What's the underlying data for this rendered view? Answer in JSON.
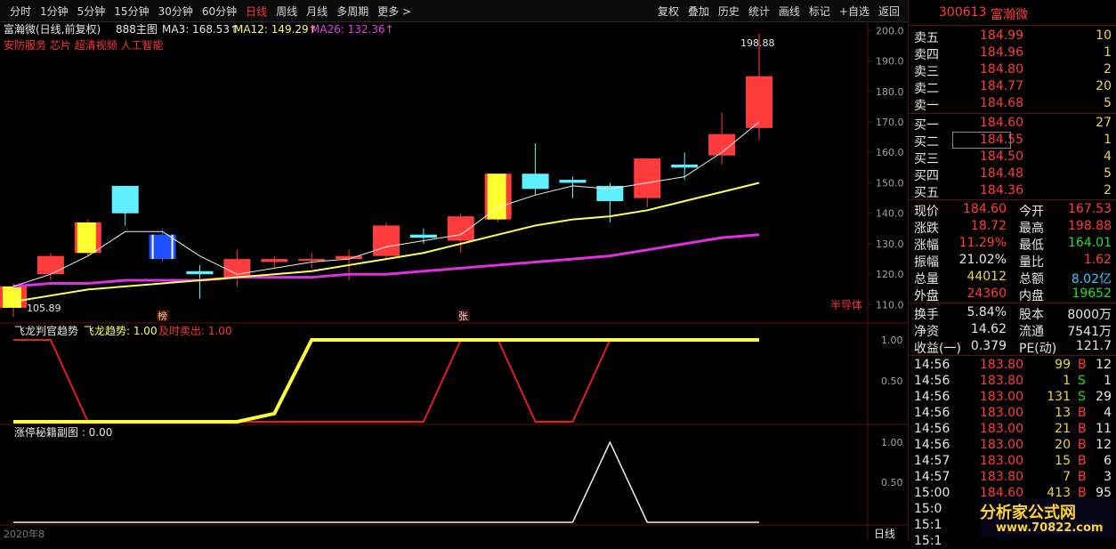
{
  "toolbar": {
    "periods": [
      {
        "label": "分时",
        "active": false
      },
      {
        "label": "1分钟",
        "active": false
      },
      {
        "label": "5分钟",
        "active": false
      },
      {
        "label": "15分钟",
        "active": false
      },
      {
        "label": "30分钟",
        "active": false
      },
      {
        "label": "60分钟",
        "active": false
      },
      {
        "label": "日线",
        "active": true
      },
      {
        "label": "周线",
        "active": false
      },
      {
        "label": "月线",
        "active": false
      },
      {
        "label": "多周期",
        "active": false
      },
      {
        "label": "更多 >",
        "active": false
      }
    ],
    "tools": [
      "复权",
      "叠加",
      "历史",
      "统计",
      "画线",
      "标记",
      "+自选",
      "返回"
    ]
  },
  "main_chart": {
    "title": "富瀚微(日线,前复权)",
    "indicator_name": "888主图",
    "ma3_label": "MA3: 168.53↑",
    "ma12_label": "MA12: 149.29↑",
    "ma26_label": "MA26: 132.36↑",
    "concepts": "安防服务 芯片 超清视频 人工智能",
    "high_label": "198.88",
    "low_label": "105.89",
    "sector_label": "半导体",
    "marker_1": "榜",
    "marker_2": "张",
    "y_ticks": [
      "200.0",
      "190.0",
      "180.0",
      "170.0",
      "160.0",
      "150.0",
      "140.0",
      "130.0",
      "120.0",
      "110.0"
    ]
  },
  "sub_chart_1": {
    "title": "飞龙判官趋势",
    "trend_label": "飞龙趋势: 1.00",
    "sell_label": "及时卖出: 1.00",
    "y_ticks": [
      "1.00",
      "0.50"
    ]
  },
  "sub_chart_2": {
    "title": "涨停秘籍副图 : 0.00",
    "y_ticks": [
      "1.00",
      "0.50"
    ]
  },
  "bottom": {
    "date_label": "2020年8",
    "period_label": "日线"
  },
  "panel": {
    "code": "300613",
    "name": "富瀚微",
    "asks": [
      {
        "label": "卖五",
        "price": "184.99",
        "vol": "10"
      },
      {
        "label": "卖四",
        "price": "184.96",
        "vol": "1"
      },
      {
        "label": "卖三",
        "price": "184.80",
        "vol": "2"
      },
      {
        "label": "卖二",
        "price": "184.77",
        "vol": "20"
      },
      {
        "label": "卖一",
        "price": "184.68",
        "vol": "5"
      }
    ],
    "bids": [
      {
        "label": "买一",
        "price": "184.60",
        "vol": "27"
      },
      {
        "label": "买二",
        "price": "184.55",
        "vol": "1"
      },
      {
        "label": "买三",
        "price": "184.50",
        "vol": "4"
      },
      {
        "label": "买四",
        "price": "184.48",
        "vol": "5"
      },
      {
        "label": "买五",
        "price": "184.36",
        "vol": "2"
      }
    ],
    "stats": [
      {
        "l1": "现价",
        "v1": "184.60",
        "c1": "red",
        "l2": "今开",
        "v2": "167.53",
        "c2": "red"
      },
      {
        "l1": "涨跌",
        "v1": "18.72",
        "c1": "red",
        "l2": "最高",
        "v2": "198.88",
        "c2": "red"
      },
      {
        "l1": "涨幅",
        "v1": "11.29%",
        "c1": "red",
        "l2": "最低",
        "v2": "164.01",
        "c2": "green"
      },
      {
        "l1": "振幅",
        "v1": "21.02%",
        "c1": "white",
        "l2": "量比",
        "v2": "1.62",
        "c2": "red"
      },
      {
        "l1": "总量",
        "v1": "44012",
        "c1": "yellow",
        "l2": "总额",
        "v2": "8.02亿",
        "c2": "cyan"
      },
      {
        "l1": "外盘",
        "v1": "24360",
        "c1": "red",
        "l2": "内盘",
        "v2": "19652",
        "c2": "green"
      }
    ],
    "stats2": [
      {
        "l1": "换手",
        "v1": "5.84%",
        "l2": "股本",
        "v2": "8000万"
      },
      {
        "l1": "净资",
        "v1": "14.62",
        "l2": "流通",
        "v2": "7541万"
      },
      {
        "l1": "收益(一)",
        "v1": "0.379",
        "l2": "PE(动)",
        "v2": "121.7"
      }
    ],
    "ticks": [
      {
        "time": "14:56",
        "price": "183.80",
        "vol": "99",
        "side": "B",
        "n": "12"
      },
      {
        "time": "14:56",
        "price": "183.80",
        "vol": "1",
        "side": "S",
        "n": "1"
      },
      {
        "time": "14:56",
        "price": "183.00",
        "vol": "131",
        "side": "S",
        "n": "29"
      },
      {
        "time": "14:56",
        "price": "183.00",
        "vol": "13",
        "side": "B",
        "n": "4"
      },
      {
        "time": "14:56",
        "price": "183.00",
        "vol": "21",
        "side": "B",
        "n": "11"
      },
      {
        "time": "14:56",
        "price": "183.00",
        "vol": "20",
        "side": "B",
        "n": "12"
      },
      {
        "time": "14:57",
        "price": "183.00",
        "vol": "15",
        "side": "B",
        "n": "6"
      },
      {
        "time": "14:57",
        "price": "183.80",
        "vol": "7",
        "side": "B",
        "n": "3"
      },
      {
        "time": "15:00",
        "price": "184.60",
        "vol": "413",
        "side": "B",
        "n": "95"
      },
      {
        "time": "15:0",
        "price": "",
        "vol": "",
        "side": "",
        "n": ""
      },
      {
        "time": "15:1",
        "price": "",
        "vol": "",
        "side": "",
        "n": ""
      },
      {
        "time": "15:1",
        "price": "",
        "vol": "",
        "side": "",
        "n": ""
      }
    ],
    "watermark_text": "分析家公式网",
    "watermark_url": "www.70822.com"
  },
  "chart_data": {
    "type": "candlestick",
    "y_range": [
      104,
      203
    ],
    "candles": [
      {
        "o": 109,
        "c": 116,
        "h": 117,
        "l": 106,
        "color": "yellow-red"
      },
      {
        "o": 120,
        "c": 126,
        "h": 127,
        "l": 118,
        "color": "red"
      },
      {
        "o": 127,
        "c": 137,
        "h": 138,
        "l": 126,
        "color": "yellow-red"
      },
      {
        "o": 149,
        "c": 140,
        "h": 149,
        "l": 136,
        "color": "cyan"
      },
      {
        "o": 133,
        "c": 125,
        "h": 135,
        "l": 124,
        "color": "blue"
      },
      {
        "o": 121,
        "c": 120,
        "h": 123,
        "l": 112,
        "color": "cyan"
      },
      {
        "o": 119,
        "c": 125,
        "h": 128,
        "l": 116,
        "color": "red"
      },
      {
        "o": 124,
        "c": 125,
        "h": 126,
        "l": 122,
        "color": "red"
      },
      {
        "o": 125,
        "c": 125,
        "h": 127,
        "l": 122,
        "color": "red"
      },
      {
        "o": 125,
        "c": 126,
        "h": 128,
        "l": 118,
        "color": "red"
      },
      {
        "o": 126,
        "c": 136,
        "h": 137,
        "l": 125,
        "color": "red"
      },
      {
        "o": 133,
        "c": 132,
        "h": 135,
        "l": 130,
        "color": "cyan"
      },
      {
        "o": 131,
        "c": 139,
        "h": 140,
        "l": 127,
        "color": "red"
      },
      {
        "o": 138,
        "c": 153,
        "h": 153,
        "l": 137,
        "color": "yellow-red"
      },
      {
        "o": 153,
        "c": 148,
        "h": 163,
        "l": 146,
        "color": "cyan"
      },
      {
        "o": 151,
        "c": 150,
        "h": 152,
        "l": 145,
        "color": "cyan"
      },
      {
        "o": 149,
        "c": 144,
        "h": 150,
        "l": 137,
        "color": "cyan"
      },
      {
        "o": 145,
        "c": 158,
        "h": 158,
        "l": 142,
        "color": "red"
      },
      {
        "o": 156,
        "c": 155,
        "h": 160,
        "l": 151,
        "color": "cyan"
      },
      {
        "o": 159,
        "c": 166,
        "h": 173,
        "l": 156,
        "color": "red"
      },
      {
        "o": 168,
        "c": 185,
        "h": 199,
        "l": 164,
        "color": "red"
      }
    ],
    "ma3": [
      116,
      120,
      126,
      134,
      134,
      126,
      120,
      122,
      124,
      125,
      129,
      131,
      133,
      142,
      146,
      149,
      148,
      150,
      152,
      160,
      170
    ],
    "ma12": [
      111,
      113,
      115,
      116,
      117,
      118,
      119,
      120,
      121,
      123,
      125,
      127,
      130,
      133,
      136,
      138,
      139,
      141,
      144,
      147,
      150
    ],
    "ma26": [
      116,
      117,
      117,
      118,
      118,
      118,
      119,
      119,
      119,
      120,
      120,
      121,
      122,
      123,
      124,
      125,
      126,
      128,
      130,
      132,
      133
    ],
    "sub1_trend": [
      0,
      0,
      0,
      0,
      0,
      0,
      0,
      0.1,
      1,
      1,
      1,
      1,
      1,
      1,
      1,
      1,
      1,
      1,
      1,
      1,
      1
    ],
    "sub1_sell": [
      1,
      1,
      0,
      0,
      0,
      0,
      0,
      0,
      0,
      0,
      0,
      0,
      1,
      1,
      0,
      0,
      1,
      1,
      1,
      1,
      1
    ],
    "sub2": [
      0,
      0,
      0,
      0,
      0,
      0,
      0,
      0,
      0,
      0,
      0,
      0,
      0,
      0,
      0,
      0,
      1,
      0,
      0,
      0,
      0
    ]
  }
}
